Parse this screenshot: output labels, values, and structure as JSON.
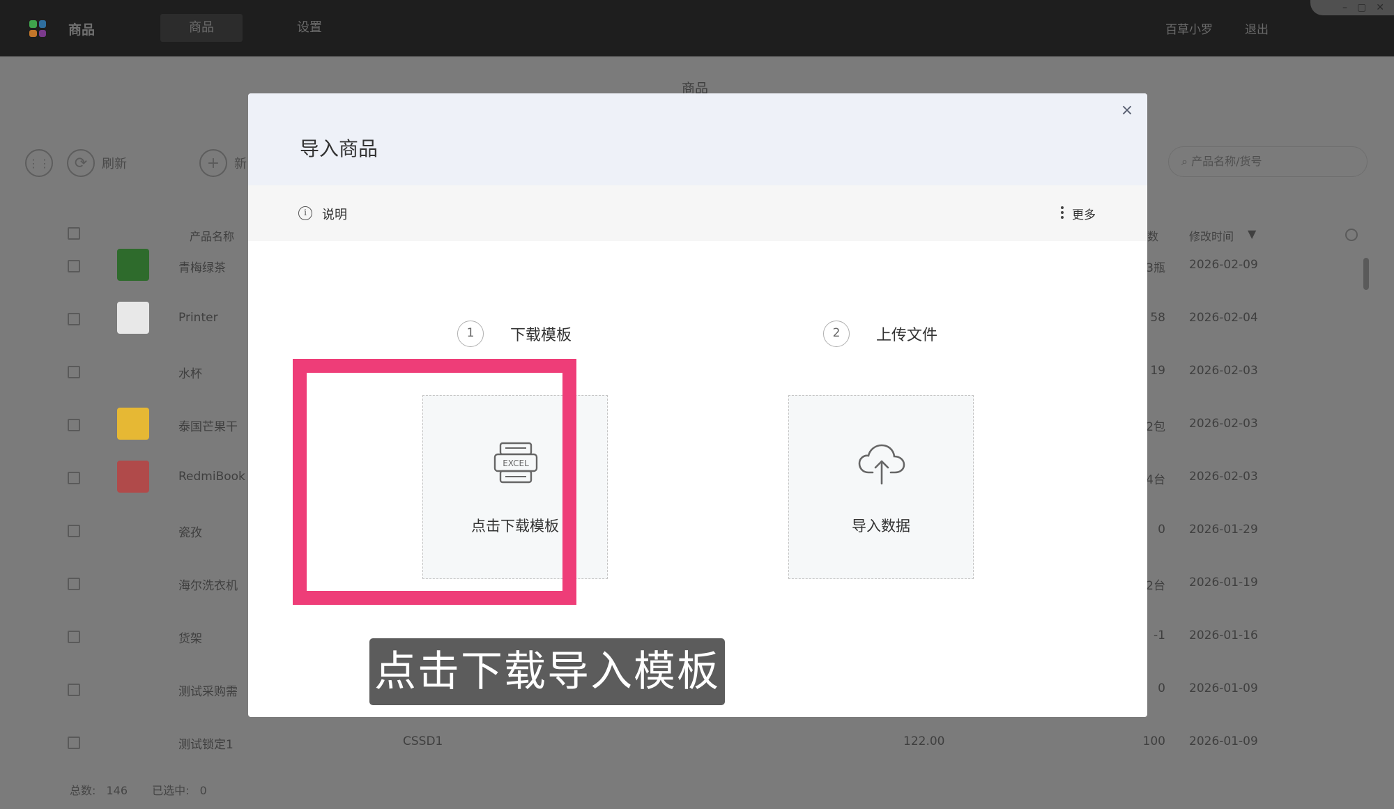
{
  "app": {
    "name": "商品",
    "tabs": [
      {
        "label": "商品"
      },
      {
        "label": "设置"
      }
    ],
    "user": "百草小罗",
    "logout": "退出",
    "window_controls": [
      "–",
      "▢",
      "✕"
    ],
    "page_title": "商品"
  },
  "toolbar": {
    "refresh": "刷新",
    "add": "新",
    "search_placeholder": "产品名称/货号"
  },
  "grid": {
    "headers": {
      "name": "产品名称",
      "qty": "数",
      "modified": "修改时间"
    },
    "rows": [
      {
        "name": "青梅绿茶",
        "qty": "3瓶",
        "date": "2026-02-09",
        "thumb_color": "#2e6b2c"
      },
      {
        "name": "Printer",
        "qty": "58",
        "date": "2026-02-04",
        "thumb_color": "#e8e8e8"
      },
      {
        "name": "水杯",
        "qty": "19",
        "date": "2026-02-03",
        "thumb_color": ""
      },
      {
        "name": "泰国芒果干",
        "qty": "2包",
        "date": "2026-02-03",
        "thumb_color": "#e6b834"
      },
      {
        "name": "RedmiBook",
        "qty": "4台",
        "date": "2026-02-03",
        "thumb_color": "#b04a4a"
      },
      {
        "name": "瓷孜",
        "qty": "0",
        "date": "2026-01-29",
        "thumb_color": ""
      },
      {
        "name": "海尔洗衣机",
        "qty": "2台",
        "date": "2026-01-19",
        "thumb_color": ""
      },
      {
        "name": "货架",
        "qty": "-1",
        "date": "2026-01-16",
        "thumb_color": ""
      },
      {
        "name": "测试采购需",
        "qty": "0",
        "date": "2026-01-09",
        "thumb_color": ""
      },
      {
        "name": "测试锁定1",
        "code": "CSSD1",
        "price": "122.00",
        "qty": "100",
        "date": "2026-01-09",
        "thumb_color": ""
      }
    ],
    "footer": {
      "total_label": "总数:",
      "total": "146",
      "selected_label": "已选中:",
      "selected": "0"
    }
  },
  "modal": {
    "title": "导入商品",
    "close": "×",
    "info_label": "说明",
    "more_label": "更多",
    "steps": [
      {
        "num": "1",
        "label": "下载模板"
      },
      {
        "num": "2",
        "label": "上传文件"
      }
    ],
    "cards": [
      {
        "label": "点击下载模板",
        "icon": "excel-icon",
        "icon_text": "EXCEL"
      },
      {
        "label": "导入数据",
        "icon": "cloud-upload-icon"
      }
    ],
    "highlight_color": "#ee3d78"
  },
  "caption": "点击下载导入模板"
}
